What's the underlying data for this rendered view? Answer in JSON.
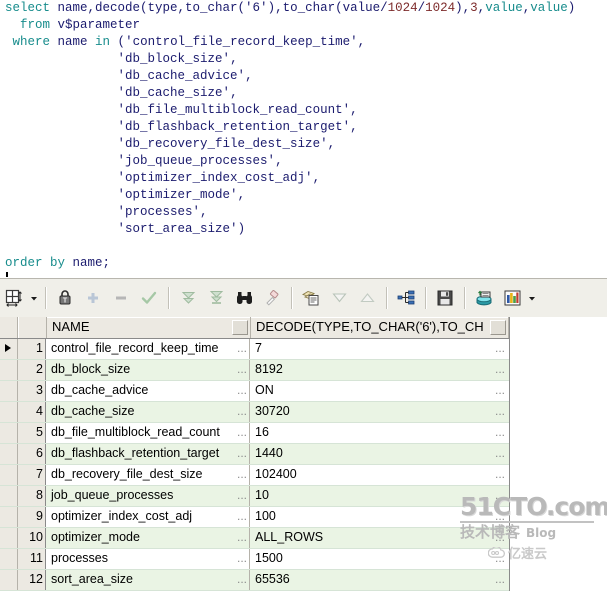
{
  "editor": {
    "lines": [
      [
        {
          "t": "select ",
          "c": "kw"
        },
        {
          "t": "name,decode(type,to_char(",
          "c": "id"
        },
        {
          "t": "'6'",
          "c": "str"
        },
        {
          "t": "),to_char(value/",
          "c": "id"
        },
        {
          "t": "1024",
          "c": "num"
        },
        {
          "t": "/",
          "c": "pun"
        },
        {
          "t": "1024",
          "c": "num"
        },
        {
          "t": "),",
          "c": "pun"
        },
        {
          "t": "3",
          "c": "num"
        },
        {
          "t": ",",
          "c": "pun"
        },
        {
          "t": "value",
          "c": "kw"
        },
        {
          "t": ",",
          "c": "pun"
        },
        {
          "t": "value",
          "c": "kw"
        },
        {
          "t": ")",
          "c": "pun"
        }
      ],
      [
        {
          "t": "  from ",
          "c": "kw"
        },
        {
          "t": "v$parameter",
          "c": "id"
        }
      ],
      [
        {
          "t": " where ",
          "c": "kw"
        },
        {
          "t": "name ",
          "c": "id"
        },
        {
          "t": "in ",
          "c": "kw"
        },
        {
          "t": "(",
          "c": "id"
        },
        {
          "t": "'control_file_record_keep_time'",
          "c": "str"
        },
        {
          "t": ",",
          "c": "id"
        }
      ],
      [
        {
          "t": "               ",
          "c": "id"
        },
        {
          "t": "'db_block_size'",
          "c": "str"
        },
        {
          "t": ",",
          "c": "id"
        }
      ],
      [
        {
          "t": "               ",
          "c": "id"
        },
        {
          "t": "'db_cache_advice'",
          "c": "str"
        },
        {
          "t": ",",
          "c": "id"
        }
      ],
      [
        {
          "t": "               ",
          "c": "id"
        },
        {
          "t": "'db_cache_size'",
          "c": "str"
        },
        {
          "t": ",",
          "c": "id"
        }
      ],
      [
        {
          "t": "               ",
          "c": "id"
        },
        {
          "t": "'db_file_multiblock_read_count'",
          "c": "str"
        },
        {
          "t": ",",
          "c": "id"
        }
      ],
      [
        {
          "t": "               ",
          "c": "id"
        },
        {
          "t": "'db_flashback_retention_target'",
          "c": "str"
        },
        {
          "t": ",",
          "c": "id"
        }
      ],
      [
        {
          "t": "               ",
          "c": "id"
        },
        {
          "t": "'db_recovery_file_dest_size'",
          "c": "str"
        },
        {
          "t": ",",
          "c": "id"
        }
      ],
      [
        {
          "t": "               ",
          "c": "id"
        },
        {
          "t": "'job_queue_processes'",
          "c": "str"
        },
        {
          "t": ",",
          "c": "id"
        }
      ],
      [
        {
          "t": "               ",
          "c": "id"
        },
        {
          "t": "'optimizer_index_cost_adj'",
          "c": "str"
        },
        {
          "t": ",",
          "c": "id"
        }
      ],
      [
        {
          "t": "               ",
          "c": "id"
        },
        {
          "t": "'optimizer_mode'",
          "c": "str"
        },
        {
          "t": ",",
          "c": "id"
        }
      ],
      [
        {
          "t": "               ",
          "c": "id"
        },
        {
          "t": "'processes'",
          "c": "str"
        },
        {
          "t": ",",
          "c": "id"
        }
      ],
      [
        {
          "t": "               ",
          "c": "id"
        },
        {
          "t": "'sort_area_size'",
          "c": "str"
        },
        {
          "t": ")",
          "c": "id"
        }
      ],
      [],
      [
        {
          "t": "order by ",
          "c": "kw"
        },
        {
          "t": "name;",
          "c": "id"
        }
      ]
    ],
    "caret_line": 15
  },
  "toolbar": {
    "groups": [
      {
        "buttons": [
          {
            "name": "grid-layout-icon",
            "label": "Grid layout",
            "icon": "grid"
          },
          {
            "name": "grid-layout-dropdown",
            "label": "Grid layout options",
            "icon": "caret"
          }
        ]
      },
      {
        "buttons": [
          {
            "name": "lock-icon",
            "label": "Lock record",
            "icon": "lock"
          },
          {
            "name": "add-record-icon",
            "label": "Insert record",
            "icon": "plus"
          },
          {
            "name": "delete-record-icon",
            "label": "Delete record",
            "icon": "minus"
          },
          {
            "name": "post-record-icon",
            "label": "Post record",
            "icon": "check"
          }
        ]
      },
      {
        "buttons": [
          {
            "name": "fetch-next-icon",
            "label": "Fetch next page",
            "icon": "dblchevron"
          },
          {
            "name": "fetch-all-icon",
            "label": "Fetch all records",
            "icon": "chevronbar"
          },
          {
            "name": "find-icon",
            "label": "Find",
            "icon": "binoculars"
          },
          {
            "name": "clear-filter-icon",
            "label": "Clear filter",
            "icon": "eraser"
          }
        ]
      },
      {
        "buttons": [
          {
            "name": "copy-icon",
            "label": "Copy to clipboard",
            "icon": "copy"
          },
          {
            "name": "sort-descending-icon",
            "label": "Sort descending",
            "icon": "tri-down"
          },
          {
            "name": "sort-ascending-icon",
            "label": "Sort ascending",
            "icon": "tri-up"
          }
        ]
      },
      {
        "buttons": [
          {
            "name": "master-detail-icon",
            "label": "Master/detail",
            "icon": "tree"
          }
        ]
      },
      {
        "buttons": [
          {
            "name": "save-icon",
            "label": "Export data",
            "icon": "floppy"
          }
        ]
      },
      {
        "buttons": [
          {
            "name": "single-record-view-icon",
            "label": "Single record view",
            "icon": "dbview"
          },
          {
            "name": "chart-icon",
            "label": "Graph",
            "icon": "chart"
          },
          {
            "name": "chart-dropdown",
            "label": "Graph options",
            "icon": "caret"
          }
        ]
      }
    ]
  },
  "grid": {
    "columns": [
      "NAME",
      "DECODE(TYPE,TO_CHAR('6'),TO_CH"
    ],
    "rows": [
      {
        "n": "1",
        "name": "control_file_record_keep_time",
        "value": "7"
      },
      {
        "n": "2",
        "name": "db_block_size",
        "value": "8192"
      },
      {
        "n": "3",
        "name": "db_cache_advice",
        "value": "ON"
      },
      {
        "n": "4",
        "name": "db_cache_size",
        "value": "30720"
      },
      {
        "n": "5",
        "name": "db_file_multiblock_read_count",
        "value": "16"
      },
      {
        "n": "6",
        "name": "db_flashback_retention_target",
        "value": "1440"
      },
      {
        "n": "7",
        "name": "db_recovery_file_dest_size",
        "value": "102400"
      },
      {
        "n": "8",
        "name": "job_queue_processes",
        "value": "10"
      },
      {
        "n": "9",
        "name": "optimizer_index_cost_adj",
        "value": "100"
      },
      {
        "n": "10",
        "name": "optimizer_mode",
        "value": "ALL_ROWS"
      },
      {
        "n": "11",
        "name": "processes",
        "value": "1500"
      },
      {
        "n": "12",
        "name": "sort_area_size",
        "value": "65536"
      }
    ],
    "current_row": 1,
    "ellipsis": "..."
  },
  "watermark": {
    "main": "51CTO.com",
    "sub_cn": "技术博客",
    "sub_en": "Blog",
    "cloud": "亿速云"
  },
  "colors": {
    "keyword": "#178c8c",
    "identifier": "#1b1b6e",
    "number": "#7d2b2b",
    "row_alt": "#eaf4e4",
    "toolbar_bg": "#f0efe9",
    "header_bg": "#ece9e2"
  }
}
